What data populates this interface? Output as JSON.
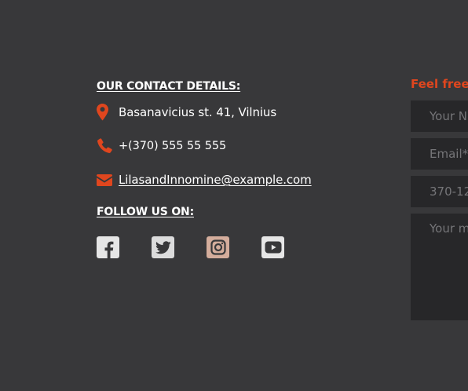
{
  "contact": {
    "title": "OUR CONTACT DETAILS:",
    "address": "Basanavicius st. 41, Vilnius",
    "phone": "+(370) 555 55 555",
    "email": "LilasandInnomine@example.com"
  },
  "follow": {
    "title": "FOLLOW US ON:",
    "networks": [
      "facebook-icon",
      "twitter-icon",
      "instagram-icon",
      "youtube-icon"
    ]
  },
  "form": {
    "title": "Feel free t",
    "name_placeholder": "Your N",
    "email_placeholder": "Email*",
    "phone_placeholder": "370-12",
    "message_placeholder": "Your m"
  },
  "colors": {
    "background": "#38383a",
    "accent": "#e0461e",
    "field_background": "#272729",
    "placeholder": "#757578"
  }
}
